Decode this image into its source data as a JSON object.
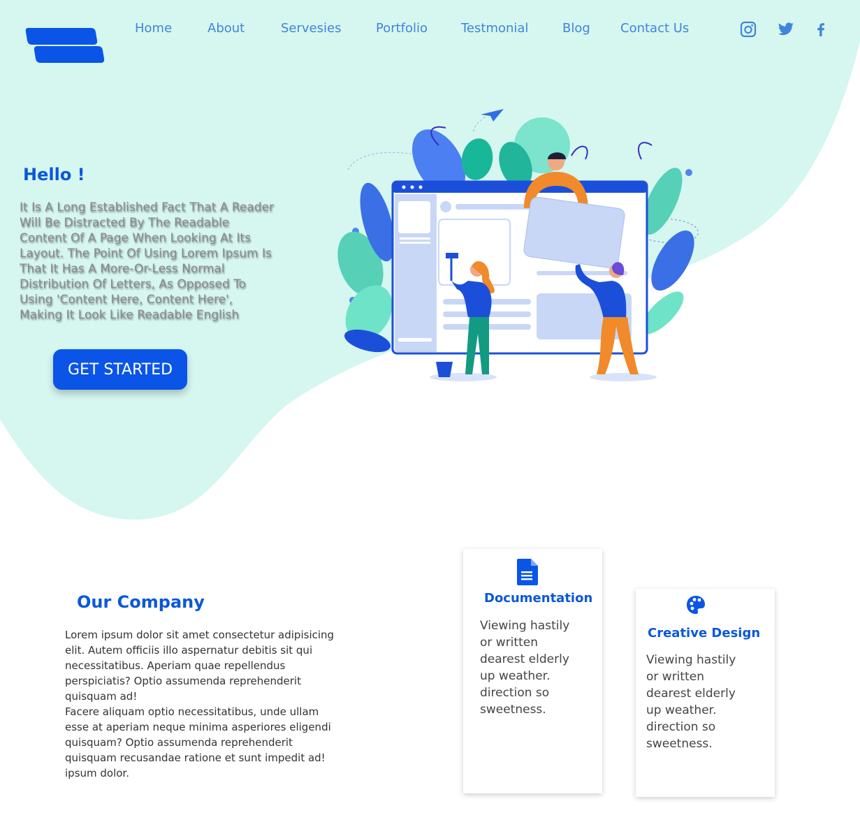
{
  "colors": {
    "accent": "#0a55e8",
    "heading": "#0a58d9",
    "nav_link": "#3f86d8",
    "hero_background": "#d6f6f0"
  },
  "logo": {
    "icon": "brand-logo"
  },
  "nav": {
    "links": [
      {
        "label": "Home"
      },
      {
        "label": "About"
      },
      {
        "label": "Servesies"
      },
      {
        "label": "Portfolio"
      },
      {
        "label": "Testmonial"
      },
      {
        "label": "Blog"
      },
      {
        "label": "Contact Us"
      }
    ]
  },
  "social": [
    {
      "icon": "instagram-icon"
    },
    {
      "icon": "twitter-icon"
    },
    {
      "icon": "facebook-icon"
    }
  ],
  "hero": {
    "heading": "Hello !",
    "text": "It Is A Long Established Fact That A Reader Will Be Distracted By The Readable Content Of A Page When Looking At Its Layout. The Point Of Using Lorem Ipsum Is That It Has A More-Or-Less Normal Distribution Of Letters, As Opposed To Using 'Content Here, Content Here', Making It Look Like Readable English",
    "cta_label": "GET STARTED",
    "illustration": "team-building-website-illustration"
  },
  "company": {
    "title": "Our Company",
    "paragraphs": [
      "Lorem ipsum dolor sit amet consectetur adipisicing elit. Autem officiis illo aspernatur debitis sit qui necessitatibus. Aperiam quae repellendus perspiciatis? Optio assumenda reprehenderit quisquam ad!",
      "Facere aliquam optio necessitatibus, unde ullam esse at aperiam neque minima asperiores eligendi quisquam? Optio assumenda reprehenderit quisquam recusandae ratione et sunt impedit ad! ipsum dolor."
    ]
  },
  "cards": [
    {
      "icon": "document-icon",
      "title": "Documentation",
      "text": "Viewing hastily or written dearest elderly up weather. direction so sweetness."
    },
    {
      "icon": "palette-icon",
      "title": "Creative Design",
      "text": "Viewing hastily or written dearest elderly up weather. direction so sweetness."
    }
  ]
}
